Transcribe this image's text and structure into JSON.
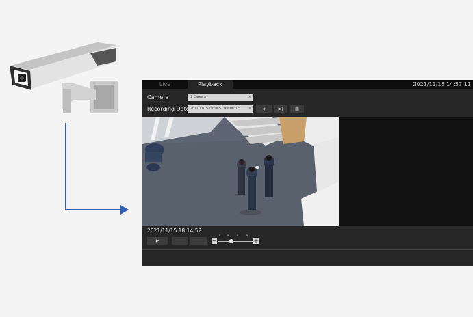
{
  "viewer": {
    "tabs": [
      {
        "label": "Live",
        "active": false
      },
      {
        "label": "Playback",
        "active": true
      }
    ],
    "clock": "2021/11/18 14:57:11",
    "camera_label": "Camera",
    "camera_value": "1_Camera",
    "recording_label": "Recording Date",
    "recording_value": "2021/11/15 18:14:52 (00:08:07)",
    "clear_glyph": "×",
    "timestamp": "2021/11/15 18:14:52",
    "zoom_minus": "−",
    "zoom_plus": "+"
  },
  "icons": {
    "play": "▶",
    "prev_clip": "◀|",
    "next_clip": "▶|",
    "calendar": "▦"
  },
  "colors": {
    "arrow": "#2f5fb0",
    "panel": "#262626",
    "video_side": "#111111"
  }
}
